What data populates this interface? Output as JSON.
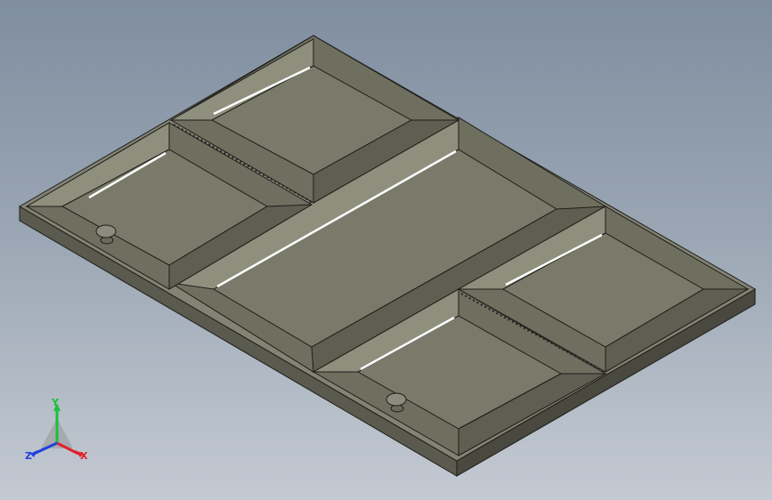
{
  "viewport": {
    "background_top": "#7f8ea0",
    "background_bottom": "#c4cad2"
  },
  "model": {
    "face_color": "#7d7d6c",
    "side_color": "#56564a",
    "edge_color": "#1e1e1a"
  },
  "triad": {
    "x_label": "X",
    "y_label": "Y",
    "z_label": "Z",
    "x_color": "#e0202a",
    "y_color": "#18c23a",
    "z_color": "#2040e0"
  }
}
